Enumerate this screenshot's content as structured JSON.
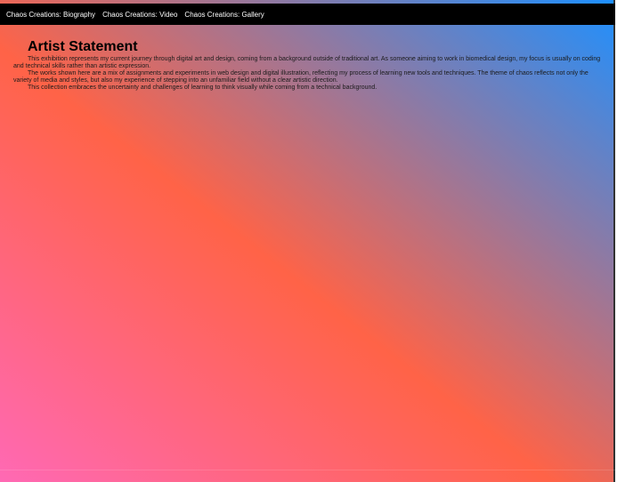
{
  "nav": {
    "links": [
      {
        "label": "Chaos Creations: Biography"
      },
      {
        "label": "Chaos Creations: Video"
      },
      {
        "label": "Chaos Creations: Gallery"
      }
    ]
  },
  "colors": {
    "topbar": "#000000",
    "gradient_pink": "#ff69b4",
    "gradient_coral": "#ff6347",
    "gradient_blue": "#1e90ff"
  },
  "main": {
    "title": "Artist Statement",
    "paragraphs": [
      "This exhibition represents my current journey through digital art and design, coming from a background outside of traditional art. As someone aiming to work in biomedical design, my focus is usually on coding and technical skills rather than artistic expression.",
      "The works shown here are a mix of assignments and experiments in web design and digital illustration, reflecting my process of learning new tools and techniques. The theme of chaos reflects not only the variety of media and styles, but also my experience of stepping into an unfamiliar field without a clear artistic direction.",
      "This collection embraces the uncertainty and challenges of learning to think visually while coming from a technical background."
    ]
  }
}
